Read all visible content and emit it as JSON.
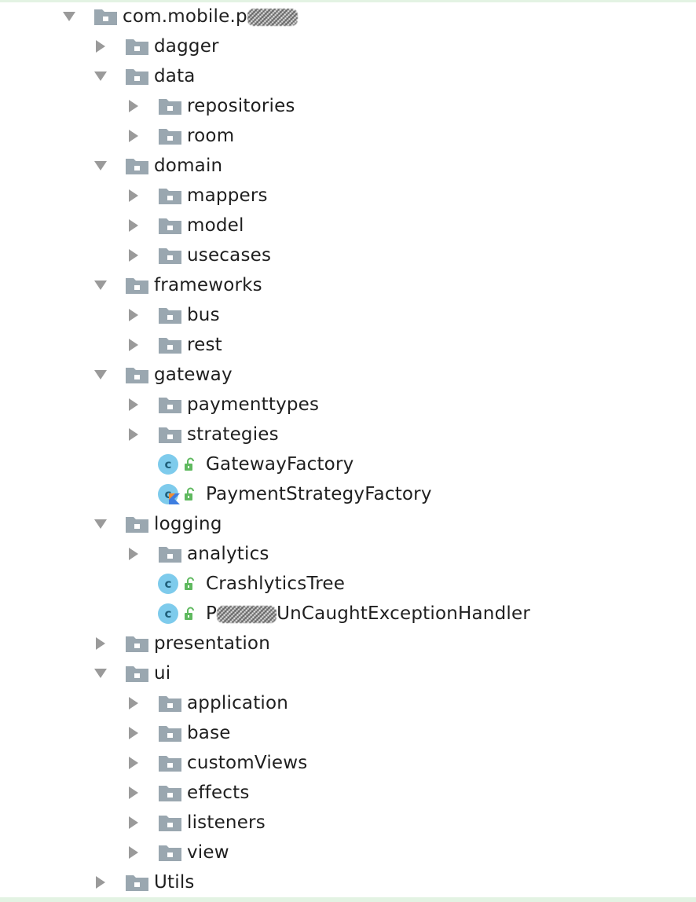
{
  "tree": {
    "root": {
      "label_prefix": "com.mobile.p",
      "expanded": true
    },
    "items": [
      {
        "id": "dagger",
        "type": "folder",
        "label": "dagger",
        "expanded": false
      },
      {
        "id": "data",
        "type": "folder",
        "label": "data",
        "expanded": true
      },
      {
        "id": "repositories",
        "type": "folder",
        "label": "repositories",
        "expanded": false
      },
      {
        "id": "room",
        "type": "folder",
        "label": "room",
        "expanded": false
      },
      {
        "id": "domain",
        "type": "folder",
        "label": "domain",
        "expanded": true
      },
      {
        "id": "mappers",
        "type": "folder",
        "label": "mappers",
        "expanded": false
      },
      {
        "id": "model",
        "type": "folder",
        "label": "model",
        "expanded": false
      },
      {
        "id": "usecases",
        "type": "folder",
        "label": "usecases",
        "expanded": false
      },
      {
        "id": "frameworks",
        "type": "folder",
        "label": "frameworks",
        "expanded": true
      },
      {
        "id": "bus",
        "type": "folder",
        "label": "bus",
        "expanded": false
      },
      {
        "id": "rest",
        "type": "folder",
        "label": "rest",
        "expanded": false
      },
      {
        "id": "gateway",
        "type": "folder",
        "label": "gateway",
        "expanded": true
      },
      {
        "id": "paymenttypes",
        "type": "folder",
        "label": "paymenttypes",
        "expanded": false
      },
      {
        "id": "strategies",
        "type": "folder",
        "label": "strategies",
        "expanded": false
      },
      {
        "id": "gatewayfactory",
        "type": "class",
        "label": "GatewayFactory",
        "kotlin": false
      },
      {
        "id": "paymentstrategyfactory",
        "type": "class",
        "label": "PaymentStrategyFactory",
        "kotlin": true
      },
      {
        "id": "logging",
        "type": "folder",
        "label": "logging",
        "expanded": true
      },
      {
        "id": "analytics",
        "type": "folder",
        "label": "analytics",
        "expanded": false
      },
      {
        "id": "crashlyticstree",
        "type": "class",
        "label": "CrashlyticsTree",
        "kotlin": false
      },
      {
        "id": "uncaughtexceptionhandler",
        "type": "class",
        "label_prefix": "P",
        "label_suffix": "UnCaughtExceptionHandler",
        "kotlin": false
      },
      {
        "id": "presentation",
        "type": "folder",
        "label": "presentation",
        "expanded": false
      },
      {
        "id": "ui",
        "type": "folder",
        "label": "ui",
        "expanded": true
      },
      {
        "id": "application",
        "type": "folder",
        "label": "application",
        "expanded": false
      },
      {
        "id": "base",
        "type": "folder",
        "label": "base",
        "expanded": false
      },
      {
        "id": "customviews",
        "type": "folder",
        "label": "customViews",
        "expanded": false
      },
      {
        "id": "effects",
        "type": "folder",
        "label": "effects",
        "expanded": false
      },
      {
        "id": "listeners",
        "type": "folder",
        "label": "listeners",
        "expanded": false
      },
      {
        "id": "view",
        "type": "folder",
        "label": "view",
        "expanded": false
      },
      {
        "id": "utils",
        "type": "folder",
        "label": "Utils",
        "expanded": false
      }
    ]
  },
  "icons": {
    "arrow": "disclosure-triangle-icon",
    "folder": "package-folder-icon",
    "class": "class-c-icon",
    "lock": "unlocked-padlock-icon",
    "kotlin": "kotlin-badge-icon"
  },
  "colors": {
    "arrow": "#9a9a9a",
    "folder": "#9aa7b0",
    "class_circle": "#7ecbec",
    "class_letter": "#1f5f7a",
    "lock": "#5fb95f",
    "kotlin_orange": "#f18e33",
    "kotlin_blue": "#3e7ee0",
    "text": "#1f1f1f",
    "frame": "#e3f3e3"
  }
}
